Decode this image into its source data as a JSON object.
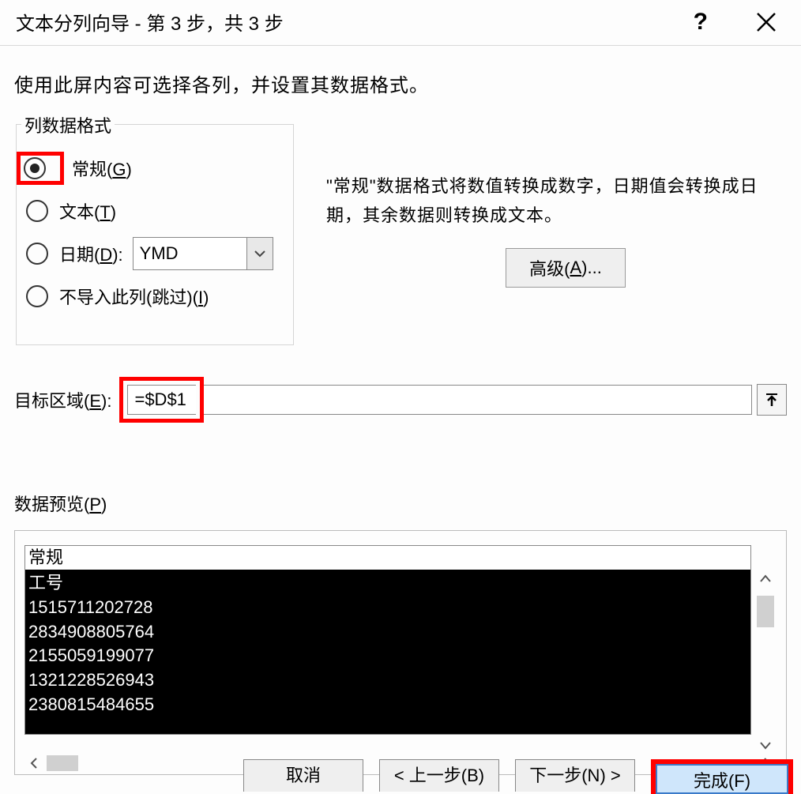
{
  "title": "文本分列向导 - 第 3 步，共 3 步",
  "instruction": "使用此屏内容可选择各列，并设置其数据格式。",
  "group": {
    "title": "列数据格式",
    "general": "常规(G)",
    "general_underline": "G",
    "text": "文本(T)",
    "text_underline": "T",
    "date": "日期(D):",
    "date_underline": "D",
    "date_value": "YMD",
    "skip": "不导入此列(跳过)(I)",
    "skip_underline": "I"
  },
  "format_desc": "\"常规\"数据格式将数值转换成数字，日期值会转换成日期，其余数据则转换成文本。",
  "advanced_btn": "高级(A)...",
  "dest": {
    "label": "目标区域(E):",
    "value": "=$D$1"
  },
  "preview": {
    "label": "数据预览(P)",
    "header": "常规",
    "rows": [
      "工号",
      "1515711202728",
      "2834908805764",
      "2155059199077",
      "1321228526943",
      "2380815484655"
    ]
  },
  "buttons": {
    "cancel": "取消",
    "back": "< 上一步(B)",
    "next": "下一步(N) >",
    "finish": "完成(F)"
  }
}
